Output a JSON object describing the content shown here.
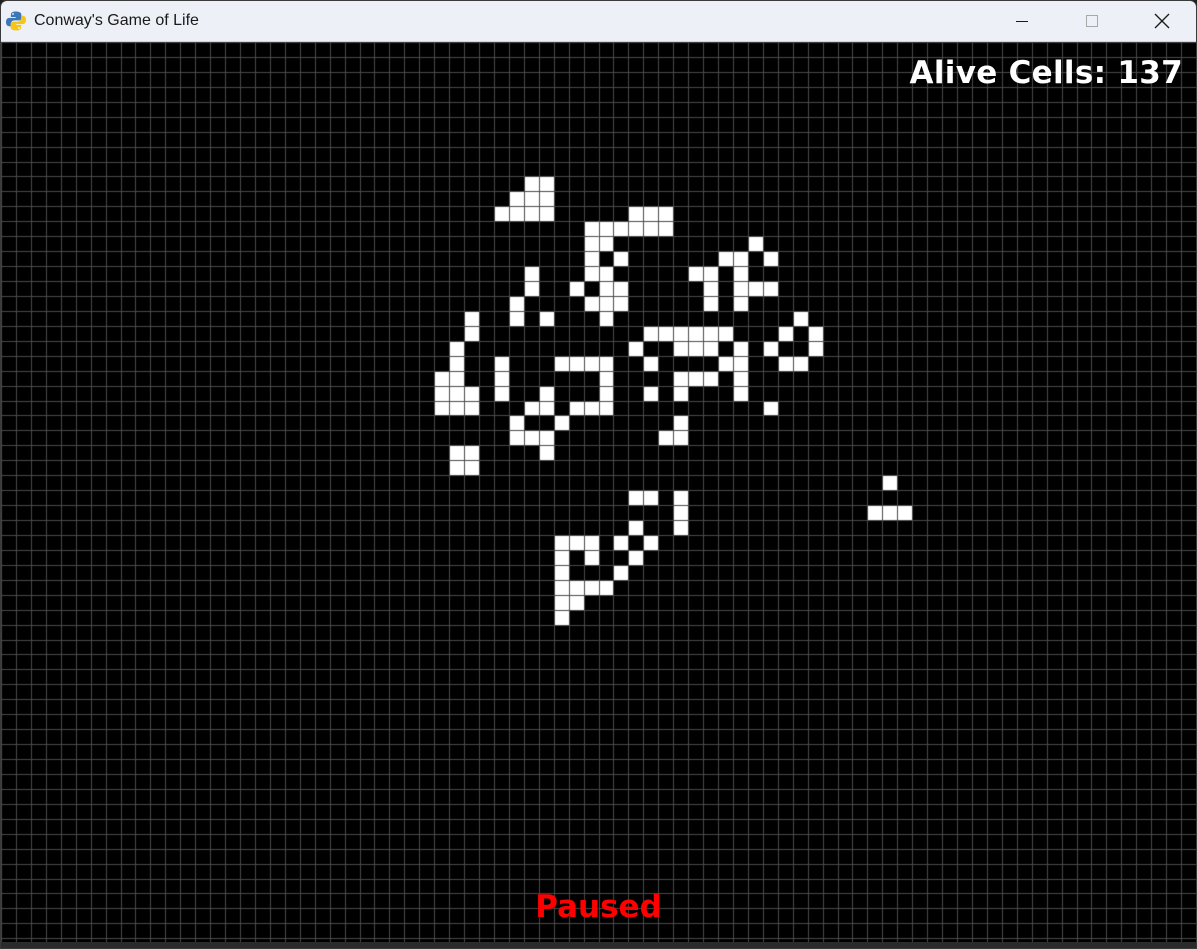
{
  "window": {
    "title": "Conway's Game of Life",
    "icon": "python-pygame-icon",
    "controls": [
      "minimize-icon",
      "maximize-icon",
      "close-icon"
    ]
  },
  "game": {
    "alive_label": "Alive Cells: 137",
    "status": "Paused",
    "status_color": "#ff0000",
    "counter_color": "#ffffff",
    "background_color": "#000000",
    "grid_line_color": "#4a4a4a",
    "cell_color": "#ffffff",
    "columns": 80,
    "rows": 60,
    "alive_cells": [
      [
        35,
        9
      ],
      [
        36,
        9
      ],
      [
        34,
        10
      ],
      [
        35,
        10
      ],
      [
        36,
        10
      ],
      [
        33,
        11
      ],
      [
        34,
        11
      ],
      [
        35,
        11
      ],
      [
        36,
        11
      ],
      [
        42,
        11
      ],
      [
        43,
        11
      ],
      [
        44,
        11
      ],
      [
        39,
        12
      ],
      [
        40,
        12
      ],
      [
        41,
        12
      ],
      [
        42,
        12
      ],
      [
        43,
        12
      ],
      [
        44,
        12
      ],
      [
        39,
        13
      ],
      [
        40,
        13
      ],
      [
        50,
        13
      ],
      [
        39,
        14
      ],
      [
        41,
        14
      ],
      [
        48,
        14
      ],
      [
        49,
        14
      ],
      [
        51,
        14
      ],
      [
        35,
        15
      ],
      [
        39,
        15
      ],
      [
        40,
        15
      ],
      [
        46,
        15
      ],
      [
        47,
        15
      ],
      [
        49,
        15
      ],
      [
        35,
        16
      ],
      [
        38,
        16
      ],
      [
        40,
        16
      ],
      [
        41,
        16
      ],
      [
        47,
        16
      ],
      [
        49,
        16
      ],
      [
        50,
        16
      ],
      [
        51,
        16
      ],
      [
        34,
        17
      ],
      [
        39,
        17
      ],
      [
        40,
        17
      ],
      [
        41,
        17
      ],
      [
        47,
        17
      ],
      [
        49,
        17
      ],
      [
        31,
        18
      ],
      [
        34,
        18
      ],
      [
        36,
        18
      ],
      [
        40,
        18
      ],
      [
        53,
        18
      ],
      [
        31,
        19
      ],
      [
        43,
        19
      ],
      [
        44,
        19
      ],
      [
        45,
        19
      ],
      [
        46,
        19
      ],
      [
        47,
        19
      ],
      [
        48,
        19
      ],
      [
        52,
        19
      ],
      [
        54,
        19
      ],
      [
        30,
        20
      ],
      [
        42,
        20
      ],
      [
        45,
        20
      ],
      [
        46,
        20
      ],
      [
        47,
        20
      ],
      [
        49,
        20
      ],
      [
        51,
        20
      ],
      [
        54,
        20
      ],
      [
        30,
        21
      ],
      [
        33,
        21
      ],
      [
        37,
        21
      ],
      [
        38,
        21
      ],
      [
        39,
        21
      ],
      [
        40,
        21
      ],
      [
        43,
        21
      ],
      [
        48,
        21
      ],
      [
        49,
        21
      ],
      [
        52,
        21
      ],
      [
        53,
        21
      ],
      [
        29,
        22
      ],
      [
        30,
        22
      ],
      [
        33,
        22
      ],
      [
        40,
        22
      ],
      [
        45,
        22
      ],
      [
        46,
        22
      ],
      [
        47,
        22
      ],
      [
        49,
        22
      ],
      [
        29,
        23
      ],
      [
        30,
        23
      ],
      [
        31,
        23
      ],
      [
        33,
        23
      ],
      [
        36,
        23
      ],
      [
        40,
        23
      ],
      [
        43,
        23
      ],
      [
        45,
        23
      ],
      [
        49,
        23
      ],
      [
        29,
        24
      ],
      [
        30,
        24
      ],
      [
        31,
        24
      ],
      [
        35,
        24
      ],
      [
        36,
        24
      ],
      [
        38,
        24
      ],
      [
        39,
        24
      ],
      [
        40,
        24
      ],
      [
        51,
        24
      ],
      [
        34,
        25
      ],
      [
        37,
        25
      ],
      [
        45,
        25
      ],
      [
        34,
        26
      ],
      [
        35,
        26
      ],
      [
        36,
        26
      ],
      [
        44,
        26
      ],
      [
        45,
        26
      ],
      [
        30,
        27
      ],
      [
        31,
        27
      ],
      [
        36,
        27
      ],
      [
        30,
        28
      ],
      [
        31,
        28
      ],
      [
        59,
        29
      ],
      [
        42,
        30
      ],
      [
        43,
        30
      ],
      [
        45,
        30
      ],
      [
        45,
        31
      ],
      [
        58,
        31
      ],
      [
        59,
        31
      ],
      [
        60,
        31
      ],
      [
        42,
        32
      ],
      [
        45,
        32
      ],
      [
        37,
        33
      ],
      [
        38,
        33
      ],
      [
        39,
        33
      ],
      [
        41,
        33
      ],
      [
        43,
        33
      ],
      [
        37,
        34
      ],
      [
        39,
        34
      ],
      [
        42,
        34
      ],
      [
        37,
        35
      ],
      [
        41,
        35
      ],
      [
        37,
        36
      ],
      [
        38,
        36
      ],
      [
        39,
        36
      ],
      [
        40,
        36
      ],
      [
        37,
        37
      ],
      [
        38,
        37
      ],
      [
        37,
        38
      ]
    ]
  }
}
